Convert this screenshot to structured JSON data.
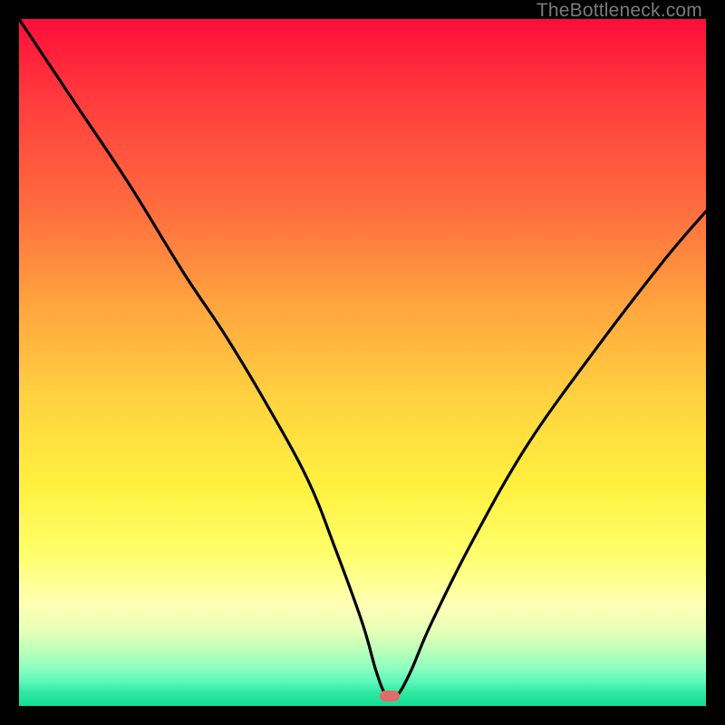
{
  "watermark": "TheBottleneck.com",
  "chart_data": {
    "type": "line",
    "title": "",
    "xlabel": "",
    "ylabel": "",
    "xlim": [
      0,
      100
    ],
    "ylim": [
      0,
      100
    ],
    "grid": false,
    "legend": false,
    "series": [
      {
        "name": "bottleneck-curve",
        "x": [
          0,
          8,
          16,
          24,
          30,
          36,
          42,
          46,
          50,
          52,
          53.5,
          55,
          57,
          60,
          66,
          74,
          84,
          94,
          100
        ],
        "values": [
          100,
          88,
          76,
          63,
          54,
          44,
          33,
          23,
          12,
          5,
          1.5,
          1.5,
          5,
          12,
          24,
          38,
          52,
          65,
          72
        ]
      }
    ],
    "marker": {
      "x": 54,
      "y": 1.5,
      "shape": "pill",
      "color": "#e46a6a"
    },
    "background_gradient": {
      "direction": "vertical",
      "stops": [
        {
          "pos": 0.0,
          "color": "#ff0d3a"
        },
        {
          "pos": 0.28,
          "color": "#ff6e3f"
        },
        {
          "pos": 0.55,
          "color": "#ffd23f"
        },
        {
          "pos": 0.78,
          "color": "#ffff6c"
        },
        {
          "pos": 0.92,
          "color": "#b9ffb9"
        },
        {
          "pos": 1.0,
          "color": "#11de96"
        }
      ]
    }
  }
}
